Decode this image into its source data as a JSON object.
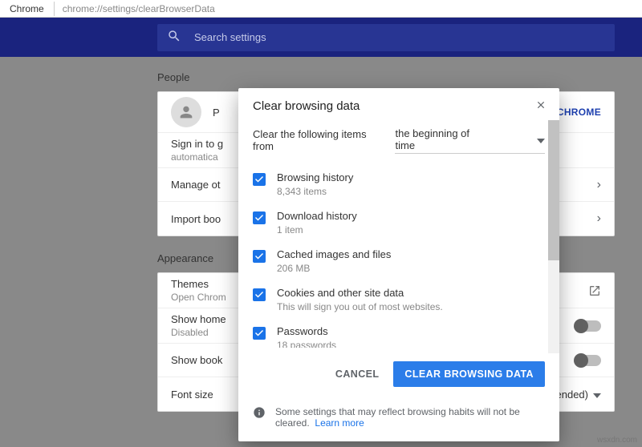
{
  "window": {
    "tab_name": "Chrome",
    "url": "chrome://settings/clearBrowserData"
  },
  "search": {
    "placeholder": "Search settings"
  },
  "sections": {
    "people": {
      "title": "People",
      "profile_name": "P",
      "sign_in_link": "O CHROME",
      "sync_hint": "Sign in to g",
      "sync_hint2": "automatica",
      "manage_people": "Manage ot",
      "import": "Import boo"
    },
    "appearance": {
      "title": "Appearance",
      "themes": "Themes",
      "themes_sub": "Open Chrom",
      "show_home": "Show home",
      "show_home_sub": "Disabled",
      "show_book": "Show book",
      "font_size": "Font size",
      "font_size_value": "Medium (Recommended)"
    }
  },
  "dialog": {
    "title": "Clear browsing data",
    "range_label": "Clear the following items from",
    "range_value": "the beginning of time",
    "options": [
      {
        "label": "Browsing history",
        "sub": "8,343 items"
      },
      {
        "label": "Download history",
        "sub": "1 item"
      },
      {
        "label": "Cached images and files",
        "sub": "206 MB"
      },
      {
        "label": "Cookies and other site data",
        "sub": "This will sign you out of most websites."
      },
      {
        "label": "Passwords",
        "sub": "18 passwords"
      }
    ],
    "cancel": "CANCEL",
    "confirm": "CLEAR BROWSING DATA",
    "footer_text": "Some settings that may reflect browsing habits will not be cleared.",
    "learn_more": "Learn more"
  },
  "watermark": "wsxdn.com"
}
